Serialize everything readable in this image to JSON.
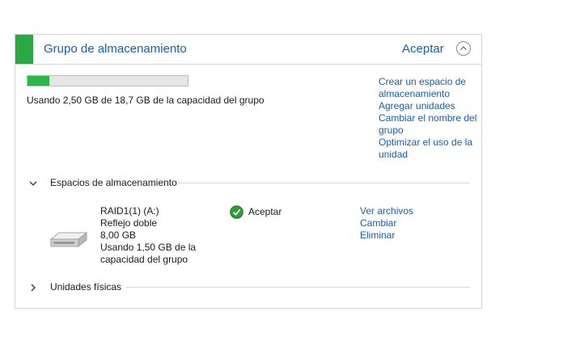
{
  "pool": {
    "title": "Grupo de almacenamiento",
    "status": "Aceptar",
    "usage_text": "Usando 2,50 GB de 18,7 GB de la capacidad del grupo",
    "usage_fraction": 0.134,
    "accent_color": "#2aa843",
    "progress_color": "#2ab84a",
    "links": [
      "Crear un espacio de almacenamiento",
      "Agregar unidades",
      "Cambiar el nombre del grupo",
      "Optimizar el uso de la unidad"
    ]
  },
  "spaces_section": {
    "label": "Espacios de almacenamiento",
    "expanded": true
  },
  "space": {
    "name": "RAID1(1) (A:)",
    "resiliency": "Reflejo doble",
    "size": "8,00 GB",
    "usage": "Usando 1,50 GB de la capacidad del grupo",
    "status": "Aceptar",
    "icon": "hard-drive-icon",
    "actions": [
      "Ver archivos",
      "Cambiar",
      "Eliminar"
    ]
  },
  "drives_section": {
    "label": "Unidades físicas",
    "expanded": false
  }
}
